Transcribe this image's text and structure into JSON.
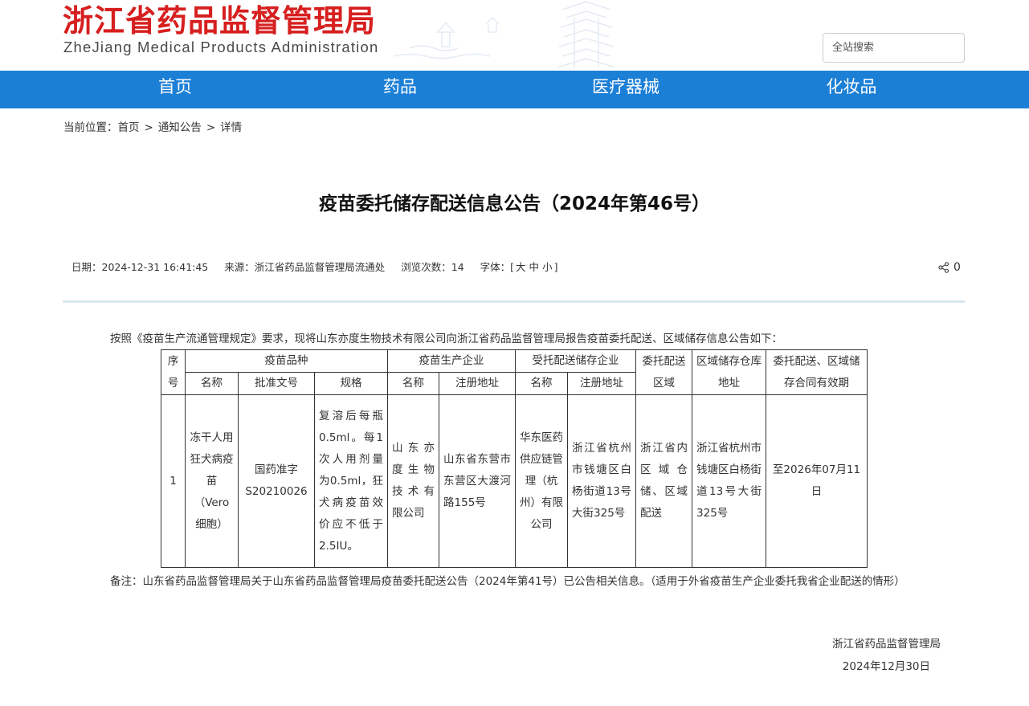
{
  "site": {
    "title": "浙江省药品监督管理局",
    "subtitle": "ZheJiang Medical Products Administration",
    "search_placeholder": "全站搜索"
  },
  "nav": [
    {
      "label": "首页"
    },
    {
      "label": "药品"
    },
    {
      "label": "医疗器械"
    },
    {
      "label": "化妆品"
    }
  ],
  "breadcrumb": {
    "prefix": "当前位置：",
    "items": [
      "首页",
      "通知公告",
      "详情"
    ],
    "separator": ">"
  },
  "article": {
    "title": "疫苗委托储存配送信息公告（2024年第46号）",
    "meta": {
      "date": "日期：2024-12-31 16:41:45",
      "source": "来源：浙江省药品监督管理局流通处",
      "views": "浏览次数：14",
      "font_label": "字体：[",
      "font_large": "大",
      "font_medium": "中",
      "font_small": "小",
      "font_close": "]"
    },
    "share_count": "0",
    "intro": "按照《疫苗生产流通管理规定》要求，现将山东亦度生物技术有限公司向浙江省药品监督管理局报告疫苗委托配送、区域储存信息公告如下：",
    "table": {
      "header_row1": {
        "seq": "序号",
        "vaccine": "疫苗品种",
        "producer": "疫苗生产企业",
        "storage_company": "受托配送储存企业",
        "delivery_area": "委托配送区域",
        "warehouse": "区域储存仓库地址",
        "validity": "委托配送、区域储存合同有效期"
      },
      "header_row2": {
        "vaccine_name": "名称",
        "approval_no": "批准文号",
        "spec": "规格",
        "producer_name": "名称",
        "producer_address": "注册地址",
        "storage_name": "名称",
        "storage_address": "注册地址"
      },
      "rows": [
        {
          "seq": "1",
          "vaccine_name": "冻干人用狂犬病疫苗（Vero细胞）",
          "approval_no": "国药准字S20210026",
          "spec": "复溶后每瓶0.5ml。每1次人用剂量为0.5ml，狂犬病疫苗效价应不低于2.5IU。",
          "producer_name": "山东亦度生物技术有限公司",
          "producer_address": "山东省东营市东营区大渡河路155号",
          "storage_name": "华东医药供应链管理（杭州）有限公司",
          "storage_address": "浙江省杭州市钱塘区白杨街道13号大街325号",
          "delivery_area": "浙江省内区域仓储、区域配送",
          "warehouse": "浙江省杭州市钱塘区白杨街道13号大街325号",
          "validity": "至2026年07月11日"
        }
      ]
    },
    "remark": "备注：山东省药品监督管理局关于山东省药品监督管理局疫苗委托配送公告（2024年第41号）已公告相关信息。（适用于外省疫苗生产企业委托我省企业配送的情形）",
    "signature": {
      "org": "浙江省药品监督管理局",
      "date": "2024年12月30日"
    }
  },
  "colors": {
    "brand_red": "#d71f1f",
    "nav_blue": "#1c7fd6",
    "divider": "#d7e6ef"
  },
  "icons": [
    "share-icon"
  ]
}
